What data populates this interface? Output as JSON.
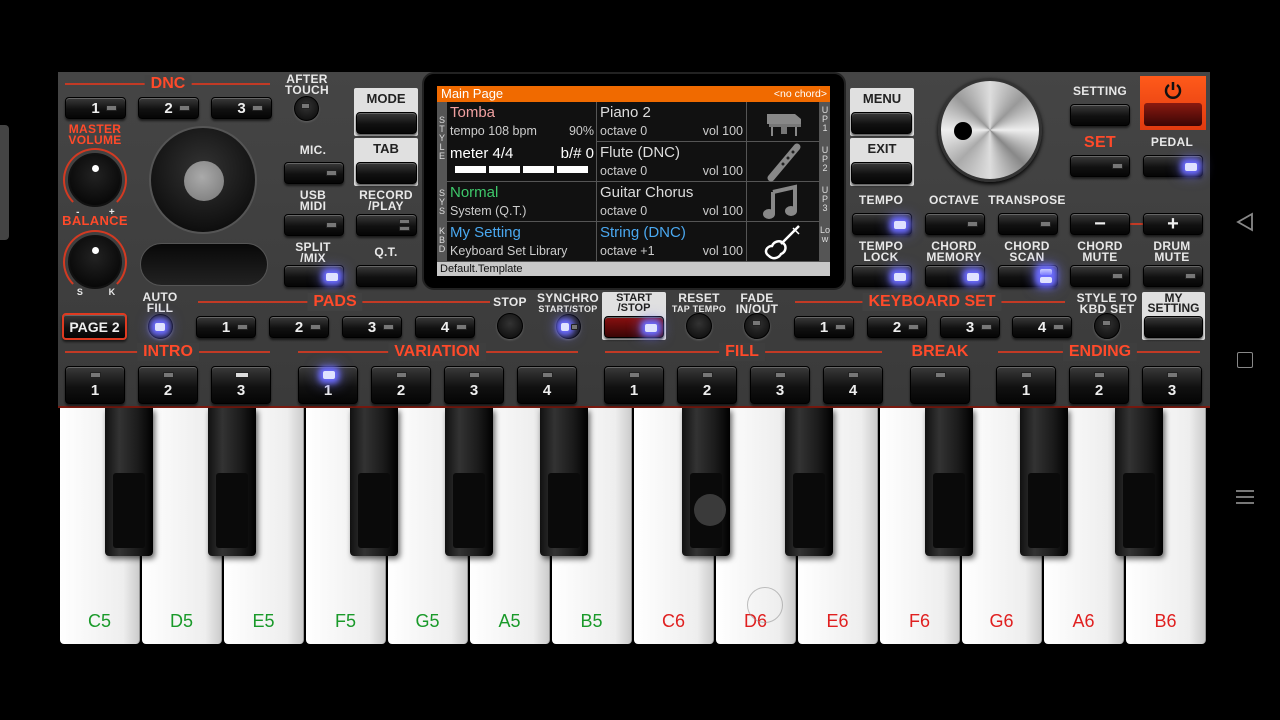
{
  "panel": {
    "dnc": {
      "title": "DNC",
      "buttons": [
        "1",
        "2",
        "3"
      ]
    },
    "after_touch": "AFTER TOUCH",
    "master_volume": "MASTER VOLUME",
    "minus": "-",
    "plus": "+",
    "balance": "BALANCE",
    "balance_s": "S",
    "balance_k": "K",
    "mic": "MIC.",
    "usb_midi": "USB MIDI",
    "split_mix": "SPLIT /MIX",
    "mode": "MODE",
    "tab": "TAB",
    "record_play": "RECORD /PLAY",
    "qt": "Q.T.",
    "menu": "MENU",
    "exit": "EXIT",
    "setting": "SETTING",
    "set": "SET",
    "pedal": "PEDAL",
    "tempo": "TEMPO",
    "octave": "OCTAVE",
    "transpose": "TRANSPOSE",
    "minus_btn": "−",
    "plus_btn": "+",
    "tempo_lock": "TEMPO LOCK",
    "chord_memory": "CHORD MEMORY",
    "chord_scan": "CHORD SCAN",
    "chord_mute": "CHORD MUTE",
    "drum_mute": "DRUM MUTE",
    "page2": "PAGE 2",
    "auto_fill": "AUTO FILL",
    "pads": {
      "title": "PADS",
      "buttons": [
        "1",
        "2",
        "3",
        "4"
      ]
    },
    "stop": "STOP",
    "synchro": "SYNCHRO",
    "synchro_sub": "START/STOP",
    "start_stop": "START /STOP",
    "reset": "RESET",
    "tap_tempo": "TAP TEMPO",
    "fade": "FADE IN/OUT",
    "keyboard_set": {
      "title": "KEYBOARD SET",
      "buttons": [
        "1",
        "2",
        "3",
        "4"
      ]
    },
    "style_to_kbd": "STYLE TO KBD SET",
    "my_setting": "MY SETTING",
    "intro": {
      "title": "INTRO",
      "buttons": [
        "1",
        "2",
        "3"
      ]
    },
    "variation": {
      "title": "VARIATION",
      "buttons": [
        "1",
        "2",
        "3",
        "4"
      ]
    },
    "fill": {
      "title": "FILL",
      "buttons": [
        "1",
        "2",
        "3",
        "4"
      ]
    },
    "break": {
      "title": "BREAK"
    },
    "ending": {
      "title": "ENDING",
      "buttons": [
        "1",
        "2",
        "3"
      ]
    }
  },
  "display": {
    "header": "Main Page",
    "chord": "<no chord>",
    "side_left": [
      "STYLE",
      "SYS",
      "KBD"
    ],
    "side_right": [
      "UP1",
      "UP2",
      "UP3",
      "Low"
    ],
    "style_name": "Tomba",
    "tempo": "tempo 108 bpm",
    "tempo_pct": "90%",
    "meter": "meter 4/4",
    "key_sig": "b/# 0",
    "beats": 4,
    "sys_name": "Normal",
    "sys_sub": "System (Q.T.)",
    "kbd_name": "My Setting",
    "kbd_sub": "Keyboard Set Library",
    "parts": [
      {
        "name": "Piano 2",
        "octave": "octave 0",
        "vol": "vol 100",
        "icon": "grand-piano-icon"
      },
      {
        "name": "Flute (DNC)",
        "octave": "octave 0",
        "vol": "vol 100",
        "icon": "flute-icon"
      },
      {
        "name": "Guitar Chorus",
        "octave": "octave 0",
        "vol": "vol 100",
        "icon": "music-note-icon"
      },
      {
        "name": "String (DNC)",
        "octave": "octave +1",
        "vol": "vol 100",
        "icon": "violin-icon"
      }
    ],
    "footer": "Default.Template"
  },
  "keys": [
    "C5",
    "D5",
    "E5",
    "F5",
    "G5",
    "A5",
    "B5",
    "C6",
    "D6",
    "E6",
    "F6",
    "G6",
    "A6",
    "B6"
  ],
  "colors": {
    "accent": "#ff4a2a",
    "octave5": "#1a9a2a",
    "octave6": "#e02020",
    "display_header": "#f06a00",
    "glow": "#6b6bff"
  }
}
